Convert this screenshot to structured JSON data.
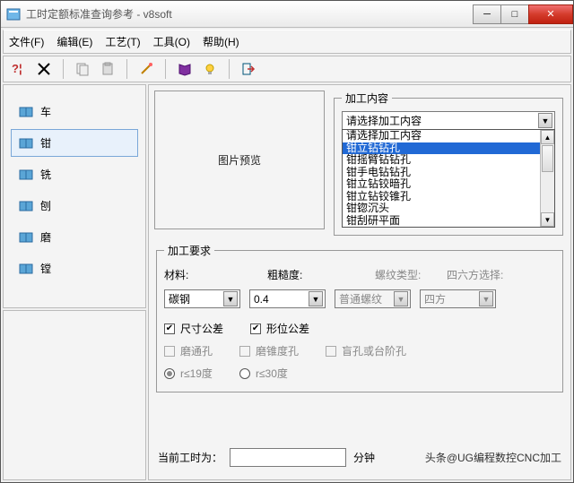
{
  "title": "工时定额标准查询参考 - v8soft",
  "menu": {
    "file": "文件(F)",
    "edit": "编辑(E)",
    "tech": "工艺(T)",
    "tool": "工具(O)",
    "help": "帮助(H)"
  },
  "nav": {
    "items": [
      {
        "label": "车"
      },
      {
        "label": "钳"
      },
      {
        "label": "铣"
      },
      {
        "label": "刨"
      },
      {
        "label": "磨"
      },
      {
        "label": "镗"
      }
    ],
    "selected_index": 1
  },
  "preview": {
    "label": "图片预览"
  },
  "content": {
    "legend": "加工内容",
    "combo_value": "请选择加工内容",
    "list_items": [
      "请选择加工内容",
      "钳立钻钻孔",
      "钳摇臂钻钻孔",
      "钳手电钻钻孔",
      "钳立钻铰暗孔",
      "钳立钻铰锥孔",
      "钳锪沉头",
      "钳刮研平面"
    ],
    "list_selected_index": 1
  },
  "requirements": {
    "legend": "加工要求",
    "material_label": "材料:",
    "material_value": "碳钢",
    "rough_label": "粗糙度:",
    "rough_value": "0.4",
    "thread_label": "螺纹类型:",
    "thread_value": "普通螺纹",
    "square_label": "四六方选择:",
    "square_value": "四方",
    "chk_size": "尺寸公差",
    "chk_shape": "形位公差",
    "chk_through": "磨通孔",
    "chk_taper": "磨锥度孔",
    "chk_blind": "盲孔或台阶孔",
    "radio_19": "r≤19度",
    "radio_30": "r≤30度"
  },
  "bottom": {
    "label": "当前工时为：",
    "unit": "分钟",
    "watermark": "头条@UG编程数控CNC加工"
  }
}
